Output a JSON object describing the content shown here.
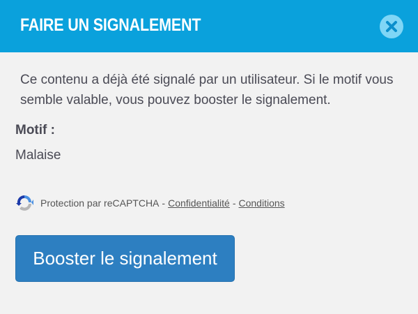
{
  "header": {
    "title": "FAIRE UN SIGNALEMENT",
    "close_icon": "close-icon",
    "background_color": "#0aa1dc"
  },
  "body": {
    "description": "Ce contenu a déjà été signalé par un utilisateur. Si le motif vous semble valable, vous pouvez booster le signalement.",
    "motif_label": "Motif :",
    "motif_value": "Malaise"
  },
  "recaptcha": {
    "icon": "recaptcha-icon",
    "text": "Protection par reCAPTCHA",
    "separator": "-",
    "privacy_link": "Confidentialité",
    "terms_link": "Conditions"
  },
  "actions": {
    "boost_label": "Booster le signalement",
    "button_color": "#2d7fc1"
  }
}
